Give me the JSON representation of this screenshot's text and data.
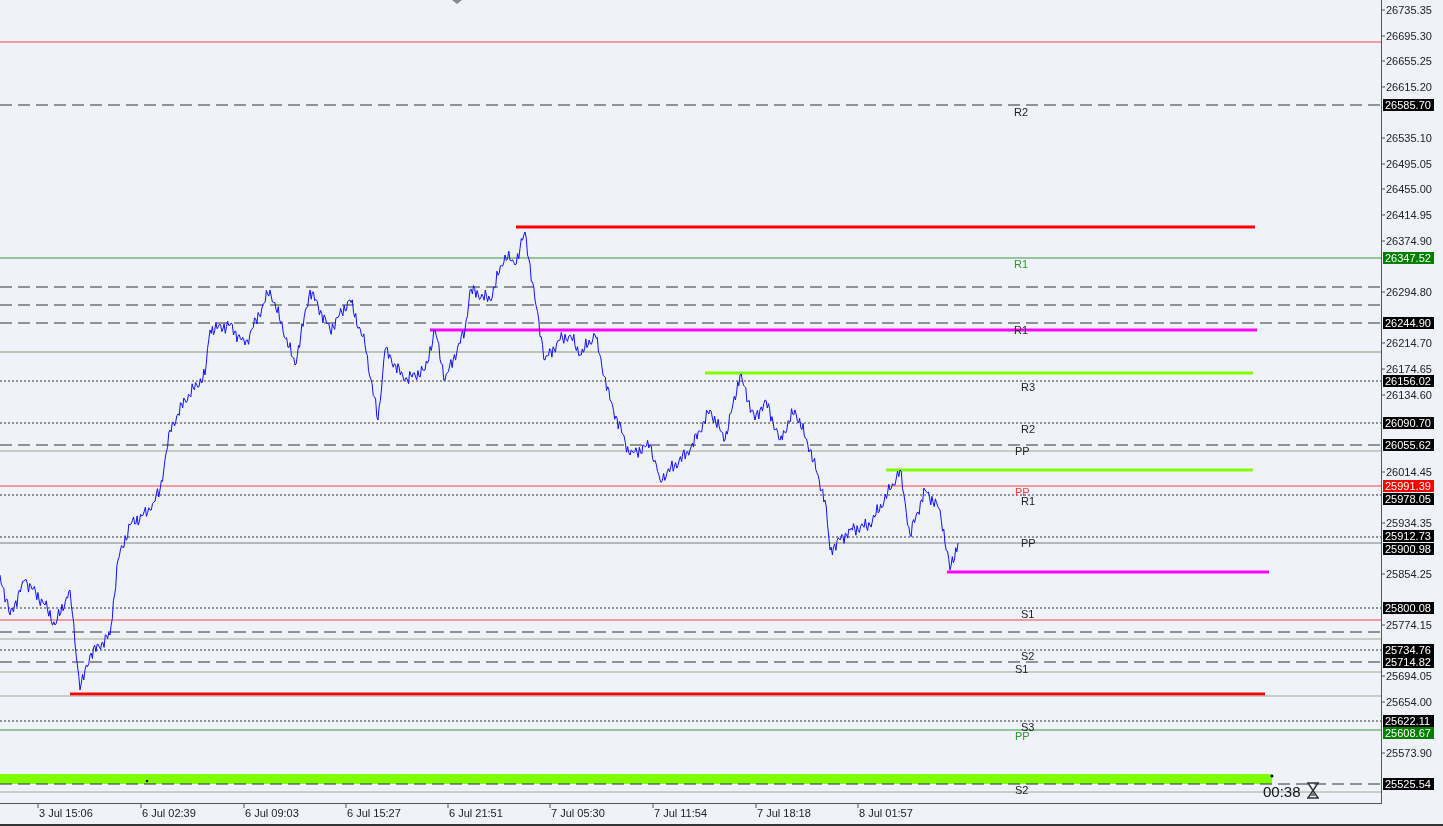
{
  "y_axis": {
    "ticks": [
      "26735.35",
      "26695.30",
      "26655.25",
      "26615.20",
      "26535.10",
      "26495.05",
      "26455.00",
      "26414.95",
      "26374.90",
      "26294.80",
      "26214.70",
      "26174.65",
      "26134.60",
      "26014.45",
      "25934.35",
      "25854.25",
      "25774.15",
      "25694.05",
      "25654.00",
      "25573.90"
    ]
  },
  "x_axis": {
    "ticks": [
      "3 Jul 15:06",
      "6 Jul 02:39",
      "6 Jul 09:03",
      "6 Jul 15:27",
      "6 Jul 21:51",
      "7 Jul 05:30",
      "7 Jul 11:54",
      "7 Jul 18:18",
      "8 Jul 01:57"
    ]
  },
  "level_labels": [
    {
      "text": "R2",
      "color": "#222222"
    },
    {
      "text": "R1",
      "color": "#2a9a2a"
    },
    {
      "text": "R1",
      "color": "#222222"
    },
    {
      "text": "R3",
      "color": "#222222"
    },
    {
      "text": "R2",
      "color": "#222222"
    },
    {
      "text": "PP",
      "color": "#222222"
    },
    {
      "text": "PP",
      "color": "#ff4040"
    },
    {
      "text": "R1",
      "color": "#222222"
    },
    {
      "text": "PP",
      "color": "#222222"
    },
    {
      "text": "S1",
      "color": "#222222"
    },
    {
      "text": "S2",
      "color": "#222222"
    },
    {
      "text": "S1",
      "color": "#222222"
    },
    {
      "text": "S3",
      "color": "#222222"
    },
    {
      "text": "PP",
      "color": "#2a9a2a"
    },
    {
      "text": "S2",
      "color": "#222222"
    }
  ],
  "price_tags": [
    {
      "text": "26585.70",
      "color": "#000000"
    },
    {
      "text": "26347.52",
      "color": "#008000"
    },
    {
      "text": "26244.90",
      "color": "#000000"
    },
    {
      "text": "26156.02",
      "color": "#000000"
    },
    {
      "text": "26090.70",
      "color": "#000000"
    },
    {
      "text": "26055.62",
      "color": "#000000"
    },
    {
      "text": "25991.39",
      "color": "#ff0000"
    },
    {
      "text": "25978.05",
      "color": "#000000"
    },
    {
      "text": "25912.73",
      "color": "#000000"
    },
    {
      "text": "25900.98",
      "color": "#000000"
    },
    {
      "text": "25800.08",
      "color": "#000000"
    },
    {
      "text": "25734.76",
      "color": "#000000"
    },
    {
      "text": "25714.82",
      "color": "#000000"
    },
    {
      "text": "25622.11",
      "color": "#000000"
    },
    {
      "text": "25608.67",
      "color": "#008000"
    },
    {
      "text": "25525.54",
      "color": "#000000"
    }
  ],
  "countdown": "00:38"
}
